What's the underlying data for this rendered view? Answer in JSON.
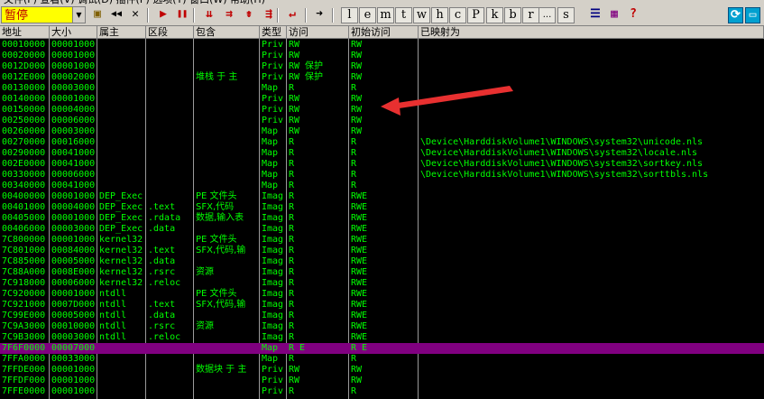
{
  "status": {
    "label": "暂停"
  },
  "toolbar": {
    "icons": [
      {
        "name": "open-icon",
        "glyph": "▣",
        "color": "#806000"
      },
      {
        "name": "rewind-icon",
        "glyph": "◀◀",
        "color": "#000000"
      },
      {
        "name": "close-icon",
        "glyph": "✕",
        "color": "#000000"
      },
      {
        "name": "run-icon",
        "glyph": "▶",
        "color": "#c00000"
      },
      {
        "name": "pause-icon",
        "glyph": "❚❚",
        "color": "#c00000"
      },
      {
        "name": "step-into-icon",
        "glyph": "⇊",
        "color": "#c00000"
      },
      {
        "name": "step-over-icon",
        "glyph": "⇉",
        "color": "#c00000"
      },
      {
        "name": "trace-into-icon",
        "glyph": "⇟",
        "color": "#c00000"
      },
      {
        "name": "trace-over-icon",
        "glyph": "⇶",
        "color": "#c00000"
      },
      {
        "name": "execute-till-return-icon",
        "glyph": "↵",
        "color": "#c00000"
      },
      {
        "name": "go-to-icon",
        "glyph": "➜",
        "color": "#000000"
      }
    ],
    "letters": [
      "l",
      "e",
      "m",
      "t",
      "w",
      "h",
      "c",
      "P",
      "k",
      "b",
      "r",
      "...",
      "s"
    ],
    "right_icons": [
      {
        "name": "list-icon",
        "glyph": "☰",
        "color": "#000080"
      },
      {
        "name": "options-icon",
        "glyph": "▦",
        "color": "#800080"
      },
      {
        "name": "help-icon",
        "glyph": "?",
        "color": "#c00000"
      }
    ],
    "window_icons": [
      {
        "name": "restore-icon",
        "glyph": "⟳",
        "color": "#ffffff",
        "bg": "#00a0d0"
      },
      {
        "name": "maximize-icon",
        "glyph": "▭",
        "color": "#ffffff",
        "bg": "#00a0d0"
      }
    ]
  },
  "columns": [
    "地址",
    "大小",
    "属主",
    "区段",
    "包含",
    "类型",
    "访问",
    "初始访问",
    "已映射为"
  ],
  "rows": [
    {
      "address": "00010000",
      "size": "00001000",
      "owner": "",
      "section": "",
      "contains": "",
      "type": "Priv",
      "access": "RW",
      "initial": "RW",
      "mapped": ""
    },
    {
      "address": "00020000",
      "size": "00001000",
      "owner": "",
      "section": "",
      "contains": "",
      "type": "Priv",
      "access": "RW",
      "initial": "RW",
      "mapped": ""
    },
    {
      "address": "0012D000",
      "size": "00001000",
      "owner": "",
      "section": "",
      "contains": "",
      "type": "Priv",
      "access": "RW  保护",
      "initial": "RW",
      "mapped": ""
    },
    {
      "address": "0012E000",
      "size": "00002000",
      "owner": "",
      "section": "",
      "contains": "堆栈 于  主",
      "type": "Priv",
      "access": "RW  保护",
      "initial": "RW",
      "mapped": ""
    },
    {
      "address": "00130000",
      "size": "00003000",
      "owner": "",
      "section": "",
      "contains": "",
      "type": "Map",
      "access": "R",
      "initial": "R",
      "mapped": ""
    },
    {
      "address": "00140000",
      "size": "00001000",
      "owner": "",
      "section": "",
      "contains": "",
      "type": "Priv",
      "access": "RW",
      "initial": "RW",
      "mapped": ""
    },
    {
      "address": "00150000",
      "size": "00004000",
      "owner": "",
      "section": "",
      "contains": "",
      "type": "Priv",
      "access": "RW",
      "initial": "RW",
      "mapped": ""
    },
    {
      "address": "00250000",
      "size": "00006000",
      "owner": "",
      "section": "",
      "contains": "",
      "type": "Priv",
      "access": "RW",
      "initial": "RW",
      "mapped": ""
    },
    {
      "address": "00260000",
      "size": "00003000",
      "owner": "",
      "section": "",
      "contains": "",
      "type": "Map",
      "access": "RW",
      "initial": "RW",
      "mapped": ""
    },
    {
      "address": "00270000",
      "size": "00016000",
      "owner": "",
      "section": "",
      "contains": "",
      "type": "Map",
      "access": "R",
      "initial": "R",
      "mapped": "\\Device\\HarddiskVolume1\\WINDOWS\\system32\\unicode.nls"
    },
    {
      "address": "00290000",
      "size": "00041000",
      "owner": "",
      "section": "",
      "contains": "",
      "type": "Map",
      "access": "R",
      "initial": "R",
      "mapped": "\\Device\\HarddiskVolume1\\WINDOWS\\system32\\locale.nls"
    },
    {
      "address": "002E0000",
      "size": "00041000",
      "owner": "",
      "section": "",
      "contains": "",
      "type": "Map",
      "access": "R",
      "initial": "R",
      "mapped": "\\Device\\HarddiskVolume1\\WINDOWS\\system32\\sortkey.nls"
    },
    {
      "address": "00330000",
      "size": "00006000",
      "owner": "",
      "section": "",
      "contains": "",
      "type": "Map",
      "access": "R",
      "initial": "R",
      "mapped": "\\Device\\HarddiskVolume1\\WINDOWS\\system32\\sorttbls.nls"
    },
    {
      "address": "00340000",
      "size": "00041000",
      "owner": "",
      "section": "",
      "contains": "",
      "type": "Map",
      "access": "R",
      "initial": "R",
      "mapped": ""
    },
    {
      "address": "00400000",
      "size": "00001000",
      "owner": "DEP_Exec",
      "section": "",
      "contains": "PE 文件头",
      "type": "Imag",
      "access": "R",
      "initial": "RWE",
      "mapped": ""
    },
    {
      "address": "00401000",
      "size": "00004000",
      "owner": "DEP_Exec",
      "section": ".text",
      "contains": "SFX,代码",
      "type": "Imag",
      "access": "R",
      "initial": "RWE",
      "mapped": ""
    },
    {
      "address": "00405000",
      "size": "00001000",
      "owner": "DEP_Exec",
      "section": ".rdata",
      "contains": "数据,输入表",
      "type": "Imag",
      "access": "R",
      "initial": "RWE",
      "mapped": ""
    },
    {
      "address": "00406000",
      "size": "00003000",
      "owner": "DEP_Exec",
      "section": ".data",
      "contains": "",
      "type": "Imag",
      "access": "R",
      "initial": "RWE",
      "mapped": ""
    },
    {
      "address": "7C800000",
      "size": "00001000",
      "owner": "kernel32",
      "section": "",
      "contains": "PE 文件头",
      "type": "Imag",
      "access": "R",
      "initial": "RWE",
      "mapped": ""
    },
    {
      "address": "7C801000",
      "size": "00084000",
      "owner": "kernel32",
      "section": ".text",
      "contains": "SFX,代码,输",
      "type": "Imag",
      "access": "R",
      "initial": "RWE",
      "mapped": ""
    },
    {
      "address": "7C885000",
      "size": "00005000",
      "owner": "kernel32",
      "section": ".data",
      "contains": "",
      "type": "Imag",
      "access": "R",
      "initial": "RWE",
      "mapped": ""
    },
    {
      "address": "7C88A000",
      "size": "0008E000",
      "owner": "kernel32",
      "section": ".rsrc",
      "contains": "资源",
      "type": "Imag",
      "access": "R",
      "initial": "RWE",
      "mapped": ""
    },
    {
      "address": "7C918000",
      "size": "00006000",
      "owner": "kernel32",
      "section": ".reloc",
      "contains": "",
      "type": "Imag",
      "access": "R",
      "initial": "RWE",
      "mapped": ""
    },
    {
      "address": "7C920000",
      "size": "00001000",
      "owner": "ntdll",
      "section": "",
      "contains": "PE 文件头",
      "type": "Imag",
      "access": "R",
      "initial": "RWE",
      "mapped": ""
    },
    {
      "address": "7C921000",
      "size": "0007D000",
      "owner": "ntdll",
      "section": ".text",
      "contains": "SFX,代码,输",
      "type": "Imag",
      "access": "R",
      "initial": "RWE",
      "mapped": ""
    },
    {
      "address": "7C99E000",
      "size": "00005000",
      "owner": "ntdll",
      "section": ".data",
      "contains": "",
      "type": "Imag",
      "access": "R",
      "initial": "RWE",
      "mapped": ""
    },
    {
      "address": "7C9A3000",
      "size": "00010000",
      "owner": "ntdll",
      "section": ".rsrc",
      "contains": "资源",
      "type": "Imag",
      "access": "R",
      "initial": "RWE",
      "mapped": ""
    },
    {
      "address": "7C9B3000",
      "size": "00003000",
      "owner": "ntdll",
      "section": ".reloc",
      "contains": "",
      "type": "Imag",
      "access": "R",
      "initial": "RWE",
      "mapped": ""
    },
    {
      "address": "7F6F0000",
      "size": "00007000",
      "owner": "",
      "section": "",
      "contains": "",
      "type": "Map",
      "access": "R E",
      "initial": "R E",
      "mapped": "",
      "selected": true
    },
    {
      "address": "7FFA0000",
      "size": "00033000",
      "owner": "",
      "section": "",
      "contains": "",
      "type": "Map",
      "access": "R",
      "initial": "R",
      "mapped": ""
    },
    {
      "address": "7FFDE000",
      "size": "00001000",
      "owner": "",
      "section": "",
      "contains": "数据块 于  主",
      "type": "Priv",
      "access": "RW",
      "initial": "RW",
      "mapped": ""
    },
    {
      "address": "7FFDF000",
      "size": "00001000",
      "owner": "",
      "section": "",
      "contains": "",
      "type": "Priv",
      "access": "RW",
      "initial": "RW",
      "mapped": ""
    },
    {
      "address": "7FFE0000",
      "size": "00001000",
      "owner": "",
      "section": "",
      "contains": "",
      "type": "Priv",
      "access": "R",
      "initial": "R",
      "mapped": ""
    }
  ],
  "colors": {
    "text": "#00ff00",
    "background": "#000000",
    "selection": "#800080",
    "annotation": "#e83030"
  }
}
